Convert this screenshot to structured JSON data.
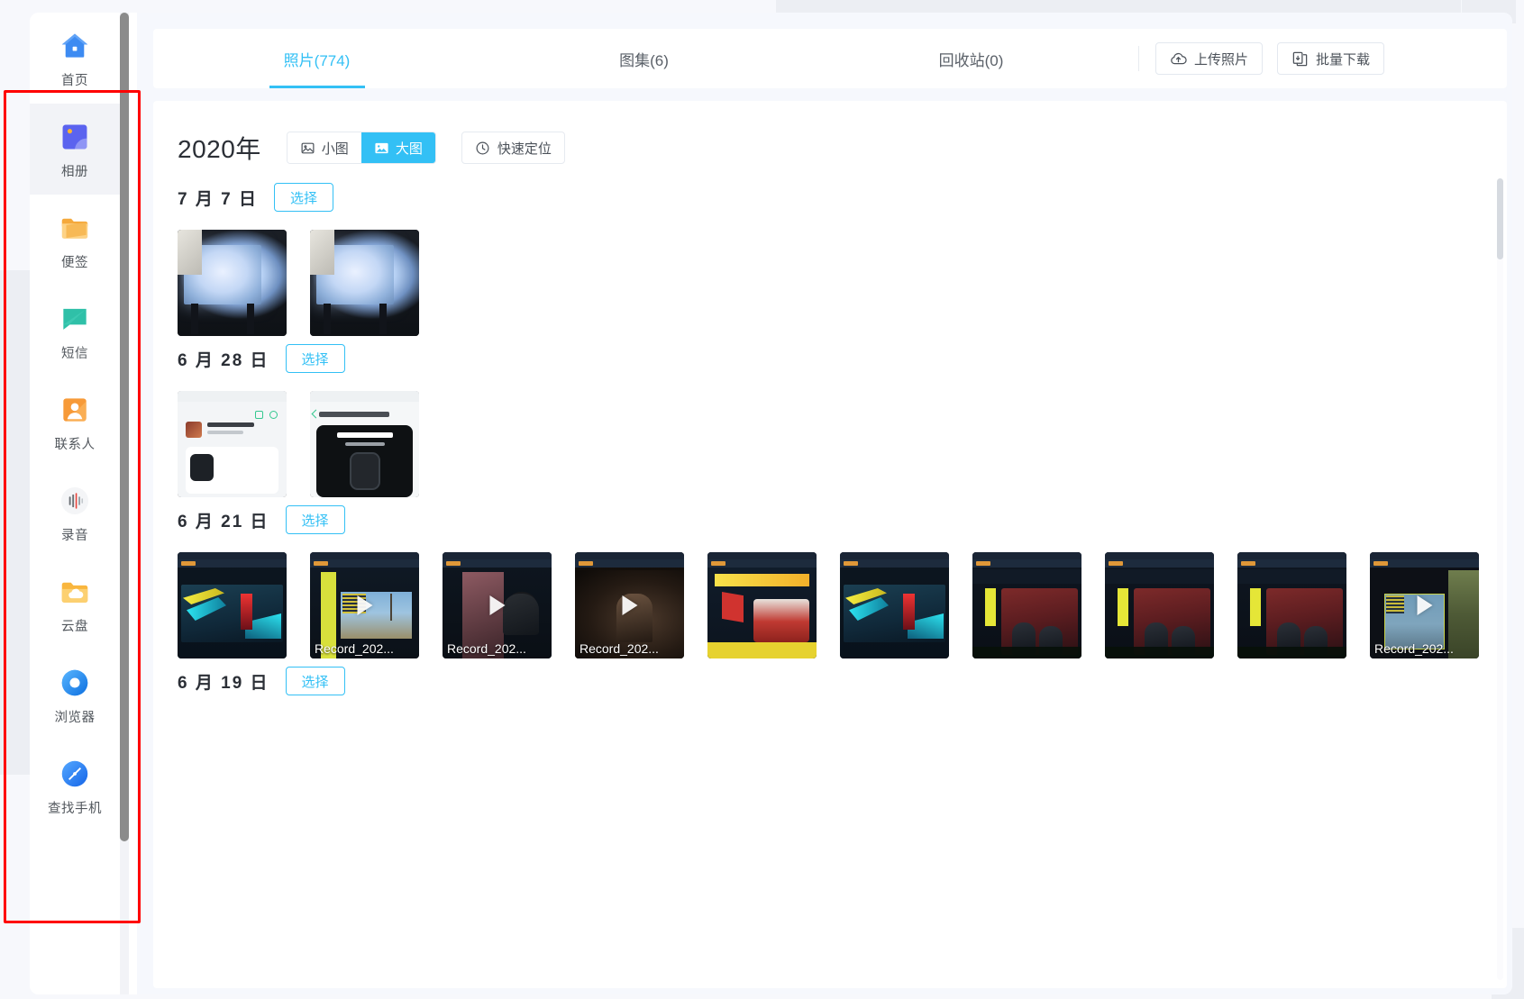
{
  "sidebar": {
    "items": [
      {
        "label": "首页",
        "icon": "home-icon",
        "active": false
      },
      {
        "label": "相册",
        "icon": "album-icon",
        "active": true
      },
      {
        "label": "便签",
        "icon": "notes-icon",
        "active": false
      },
      {
        "label": "短信",
        "icon": "sms-icon",
        "active": false
      },
      {
        "label": "联系人",
        "icon": "contacts-icon",
        "active": false
      },
      {
        "label": "录音",
        "icon": "recorder-icon",
        "active": false
      },
      {
        "label": "云盘",
        "icon": "cloud-drive-icon",
        "active": false
      },
      {
        "label": "浏览器",
        "icon": "browser-icon",
        "active": false
      },
      {
        "label": "查找手机",
        "icon": "find-phone-icon",
        "active": false
      }
    ]
  },
  "header": {
    "tabs": [
      {
        "label": "照片(774)",
        "active": true
      },
      {
        "label": "图集(6)",
        "active": false
      },
      {
        "label": "回收站(0)",
        "active": false
      }
    ],
    "upload_label": "上传照片",
    "batch_download_label": "批量下载"
  },
  "toolbar": {
    "year_title": "2020年",
    "view_small_label": "小图",
    "view_large_label": "大图",
    "view_active": "大图",
    "quick_locate_label": "快速定位"
  },
  "labels": {
    "select": "选择"
  },
  "groups": [
    {
      "date": "7 月 7 日",
      "items": [
        {
          "art": "art-proj",
          "video": false,
          "name": ""
        },
        {
          "art": "art-proj",
          "video": false,
          "name": ""
        }
      ]
    },
    {
      "date": "6 月 28 日",
      "items": [
        {
          "art": "art-chat",
          "video": false,
          "name": ""
        },
        {
          "art": "art-oppo",
          "video": false,
          "name": ""
        }
      ]
    },
    {
      "date": "6 月 21 日",
      "items": [
        {
          "art": "art-aces",
          "video": false,
          "name": ""
        },
        {
          "art": "art-game-b",
          "video": true,
          "name": "Record_202..."
        },
        {
          "art": "art-game-c",
          "video": true,
          "name": "Record_202..."
        },
        {
          "art": "art-game-d",
          "video": true,
          "name": "Record_202..."
        },
        {
          "art": "art-win",
          "video": false,
          "name": ""
        },
        {
          "art": "art-aces",
          "video": false,
          "name": ""
        },
        {
          "art": "art-esports",
          "video": false,
          "name": ""
        },
        {
          "art": "art-esports",
          "video": false,
          "name": ""
        },
        {
          "art": "art-esports",
          "video": false,
          "name": ""
        },
        {
          "art": "art-map",
          "video": true,
          "name": "Record_202..."
        }
      ]
    },
    {
      "date": "6 月 19 日",
      "items": []
    }
  ],
  "colors": {
    "accent": "#33c0f5",
    "highlight": "#ff0000",
    "text": "#2b2f36",
    "muted": "#5a6068"
  }
}
